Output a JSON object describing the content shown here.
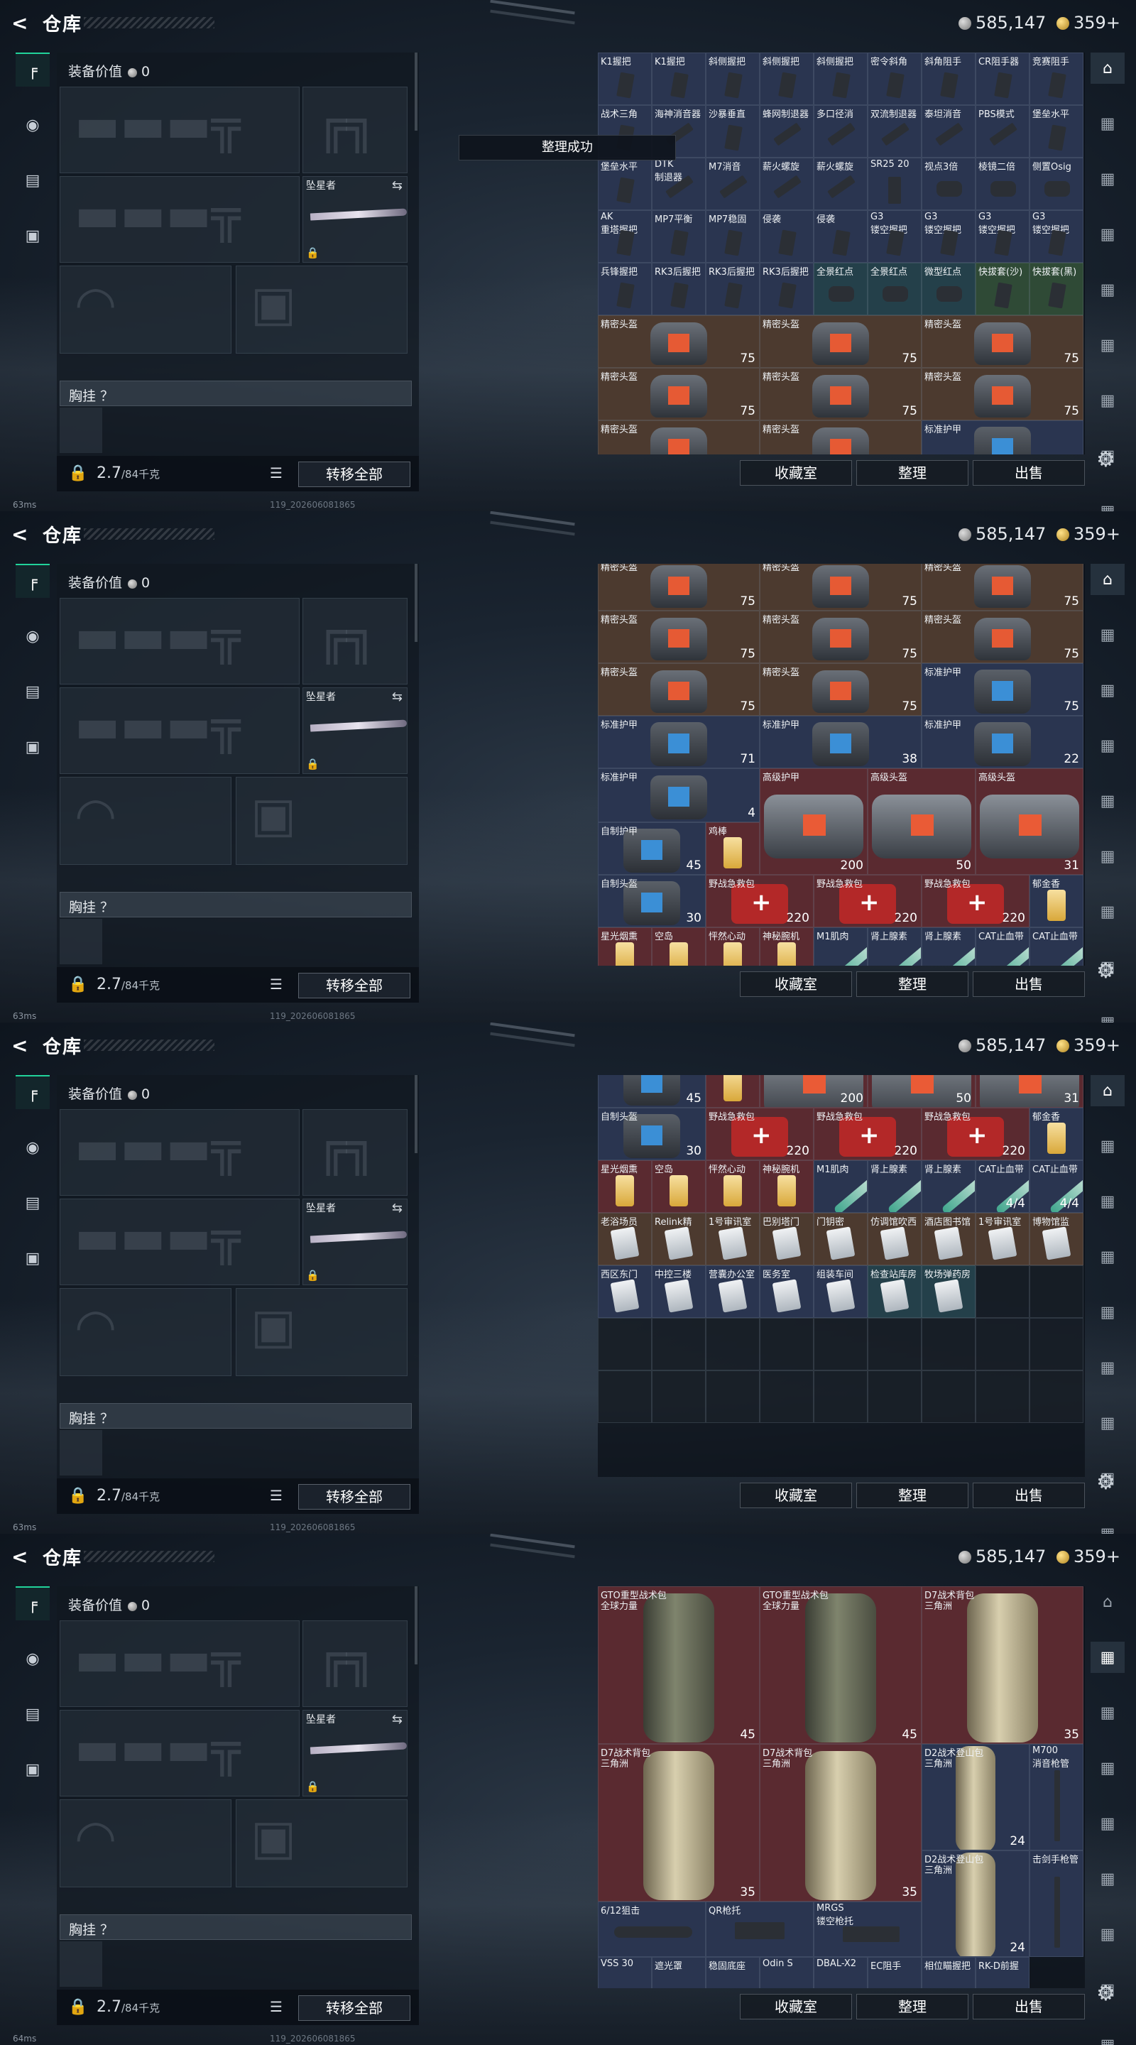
{
  "header": {
    "back_icon": "back-arrow-icon",
    "title": "仓库",
    "silver": "585,147",
    "gold": "359",
    "plus": "+"
  },
  "equipment": {
    "value_label": "装备价值",
    "value": "0",
    "knife_label": "坠星者",
    "chest_label": "胸挂 ？",
    "weight": "2.7",
    "weight_max": "/84千克",
    "transfer_label": "转移全部"
  },
  "toast": "整理成功",
  "buttons": {
    "vault": "收藏室",
    "sort": "整理",
    "sell": "出售"
  },
  "status": {
    "ping1": "63ms",
    "ping2": "63ms",
    "ping3": "63ms",
    "ping4": "64ms",
    "build": "119_202606081865"
  },
  "colors": {
    "blue_cell": "#2a3550",
    "gray_cell": "#2a2f38",
    "brown_cell": "#4c3a2f",
    "red_cell": "#5a2a30",
    "teal_cell": "#24404a",
    "green_cell": "#2f4a36",
    "accent": "#21d39a"
  },
  "frames": [
    {
      "cells": [
        {
          "n": "K1握把",
          "c": "blue",
          "g": "grip"
        },
        {
          "n": "K1握把",
          "c": "blue",
          "g": "grip"
        },
        {
          "n": "斜侧握把",
          "c": "blue",
          "g": "grip"
        },
        {
          "n": "斜侧握把",
          "c": "blue",
          "g": "grip"
        },
        {
          "n": "斜侧握把",
          "c": "blue",
          "g": "grip"
        },
        {
          "n": "密令斜角",
          "c": "blue",
          "g": "grip"
        },
        {
          "n": "斜角阻手",
          "c": "blue",
          "g": "grip"
        },
        {
          "n": "CR阻手器",
          "c": "blue",
          "g": "grip"
        },
        {
          "n": "竞赛阻手",
          "c": "blue",
          "g": "grip"
        },
        {
          "n": "战术三角",
          "c": "blue",
          "g": "grip"
        },
        {
          "n": "海神消音器",
          "c": "blue",
          "g": "sup"
        },
        {
          "n": "沙暴垂直",
          "c": "blue",
          "g": "grip"
        },
        {
          "n": "蜂网制退器",
          "c": "blue",
          "g": "sup"
        },
        {
          "n": "多口径消",
          "c": "blue",
          "g": "sup"
        },
        {
          "n": "双流制退器",
          "c": "blue",
          "g": "sup"
        },
        {
          "n": "泰坦消音",
          "c": "blue",
          "g": "sup"
        },
        {
          "n": "PBS模式",
          "c": "blue",
          "g": "sup"
        },
        {
          "n": "堡垒水平",
          "c": "blue",
          "g": "grip"
        },
        {
          "n": "堡垒水平",
          "c": "blue",
          "g": "grip"
        },
        {
          "n": "DTK",
          "n2": "制退器",
          "c": "blue",
          "g": "sup"
        },
        {
          "n": "M7消音",
          "c": "blue",
          "g": "sup"
        },
        {
          "n": "薪火螺旋",
          "c": "blue",
          "g": "sup"
        },
        {
          "n": "薪火螺旋",
          "c": "blue",
          "g": "sup"
        },
        {
          "n": "SR25 20",
          "c": "blue",
          "g": "mag"
        },
        {
          "n": "视点3倍",
          "c": "blue",
          "g": "scope"
        },
        {
          "n": "棱镜二倍",
          "c": "blue",
          "g": "scope"
        },
        {
          "n": "侧置Osig",
          "c": "blue",
          "g": "scope"
        },
        {
          "n": "AK",
          "n2": "重塔握把",
          "c": "blue",
          "g": "grip"
        },
        {
          "n": "MP7平衡",
          "c": "blue",
          "g": "grip"
        },
        {
          "n": "MP7稳固",
          "c": "blue",
          "g": "grip"
        },
        {
          "n": "侵袭",
          "c": "blue",
          "g": "grip"
        },
        {
          "n": "侵袭",
          "c": "blue",
          "g": "grip"
        },
        {
          "n": "G3",
          "n2": "镂空握把",
          "c": "blue",
          "g": "grip"
        },
        {
          "n": "G3",
          "n2": "镂空握把",
          "c": "blue",
          "g": "grip"
        },
        {
          "n": "G3",
          "n2": "镂空握把",
          "c": "blue",
          "g": "grip"
        },
        {
          "n": "G3",
          "n2": "镂空握把",
          "c": "blue",
          "g": "grip"
        },
        {
          "n": "兵锋握把",
          "c": "blue",
          "g": "grip"
        },
        {
          "n": "RK3后握把",
          "c": "blue",
          "g": "grip"
        },
        {
          "n": "RK3后握把",
          "c": "blue",
          "g": "grip"
        },
        {
          "n": "RK3后握把",
          "c": "blue",
          "g": "grip"
        },
        {
          "n": "全景红点",
          "c": "teal",
          "g": "scope"
        },
        {
          "n": "全景红点",
          "c": "teal",
          "g": "scope"
        },
        {
          "n": "微型红点",
          "c": "teal",
          "g": "scope"
        },
        {
          "n": "快拔套(沙)",
          "c": "green",
          "g": "grip"
        },
        {
          "n": "快拔套(黑)",
          "c": "green",
          "g": "grip"
        }
      ],
      "wide": [
        {
          "n": "精密头盔",
          "v": "75",
          "c": "brown",
          "k": "helm"
        },
        {
          "n": "精密头盔",
          "v": "75",
          "c": "brown",
          "k": "helm"
        },
        {
          "n": "精密头盔",
          "v": "75",
          "c": "brown",
          "k": "helm"
        },
        {
          "n": "精密头盔",
          "v": "75",
          "c": "brown",
          "k": "helm"
        },
        {
          "n": "精密头盔",
          "v": "75",
          "c": "brown",
          "k": "helm"
        },
        {
          "n": "精密头盔",
          "v": "75",
          "c": "brown",
          "k": "helm"
        },
        {
          "n": "精密头盔",
          "v": "",
          "c": "brown",
          "k": "helm"
        },
        {
          "n": "精密头盔",
          "v": "",
          "c": "brown",
          "k": "helm"
        },
        {
          "n": "标准护甲",
          "v": "",
          "c": "blue",
          "k": "vest"
        }
      ]
    },
    {
      "wide": [
        {
          "n": "精密头盔",
          "v": "75",
          "c": "brown",
          "k": "helm"
        },
        {
          "n": "精密头盔",
          "v": "75",
          "c": "brown",
          "k": "helm"
        },
        {
          "n": "精密头盔",
          "v": "75",
          "c": "brown",
          "k": "helm"
        },
        {
          "n": "精密头盔",
          "v": "75",
          "c": "brown",
          "k": "helm"
        },
        {
          "n": "精密头盔",
          "v": "75",
          "c": "brown",
          "k": "helm"
        },
        {
          "n": "精密头盔",
          "v": "75",
          "c": "brown",
          "k": "helm"
        },
        {
          "n": "精密头盔",
          "v": "75",
          "c": "brown",
          "k": "helm"
        },
        {
          "n": "精密头盔",
          "v": "75",
          "c": "brown",
          "k": "helm"
        },
        {
          "n": "标准护甲",
          "v": "75",
          "c": "blue",
          "k": "vest"
        },
        {
          "n": "标准护甲",
          "v": "71",
          "c": "blue",
          "k": "vest"
        },
        {
          "n": "标准护甲",
          "v": "38",
          "c": "blue",
          "k": "vest"
        },
        {
          "n": "标准护甲",
          "v": "22",
          "c": "blue",
          "k": "vest"
        },
        {
          "n": "标准护甲",
          "v": "4",
          "c": "blue",
          "k": "vest"
        },
        {
          "n": "高级护甲",
          "v": "200",
          "c": "red",
          "k": "bigvest"
        },
        {
          "n": "高级头盔",
          "v": "50",
          "c": "red",
          "k": "bigvest"
        },
        {
          "n": "高级头盔",
          "v": "31",
          "c": "red",
          "k": "bigvest"
        }
      ],
      "misc": [
        {
          "n": "自制护甲",
          "v": "45",
          "c": "blue"
        },
        {
          "n": "鸡棒",
          "v": "",
          "c": "red"
        },
        {
          "n": "自制头盔",
          "v": "30",
          "c": "blue"
        },
        {
          "n": "野战急救包",
          "v": "220",
          "c": "red"
        },
        {
          "n": "野战急救包",
          "v": "220",
          "c": "red"
        },
        {
          "n": "野战急救包",
          "v": "220",
          "c": "red"
        },
        {
          "n": "郁金香",
          "v": "",
          "c": "blue"
        },
        {
          "n": "星光烟熏",
          "c": "red"
        },
        {
          "n": "空岛",
          "c": "red"
        },
        {
          "n": "怦然心动",
          "c": "red"
        },
        {
          "n": "神秘腕机",
          "c": "red"
        },
        {
          "n": "M1肌肉",
          "c": "blue"
        },
        {
          "n": "肾上腺素",
          "c": "blue"
        },
        {
          "n": "肾上腺素",
          "c": "blue"
        },
        {
          "n": "CAT止血带",
          "c": "blue"
        },
        {
          "n": "CAT止血带",
          "c": "blue"
        }
      ]
    },
    {
      "row1": [
        {
          "n": "星光烟熏",
          "c": "red",
          "k": "drink"
        },
        {
          "n": "空岛",
          "c": "red",
          "k": "drink"
        },
        {
          "n": "怦然心动",
          "c": "red",
          "k": "drink"
        },
        {
          "n": "神秘腕机",
          "c": "red",
          "k": "drink"
        },
        {
          "n": "M1肌肉",
          "c": "blue",
          "k": "tube"
        },
        {
          "n": "肾上腺素",
          "c": "blue",
          "k": "tube"
        },
        {
          "n": "肾上腺素",
          "c": "blue",
          "k": "tube"
        },
        {
          "n": "CAT止血带",
          "v": "4/4",
          "c": "blue",
          "k": "tube"
        },
        {
          "n": "CAT止血带",
          "v": "4/4",
          "c": "blue",
          "k": "tube"
        }
      ],
      "row2": [
        {
          "n": "老浴场员",
          "c": "brown",
          "k": "card"
        },
        {
          "n": "Relink精",
          "c": "brown",
          "k": "card"
        },
        {
          "n": "1号审讯室",
          "c": "brown",
          "k": "card"
        },
        {
          "n": "巴别塔门",
          "c": "brown",
          "k": "card"
        },
        {
          "n": "门钥密",
          "c": "brown",
          "k": "card"
        },
        {
          "n": "仿调馆吹西",
          "c": "brown",
          "k": "card"
        },
        {
          "n": "酒店图书馆",
          "c": "brown",
          "k": "card"
        },
        {
          "n": "1号审讯室",
          "c": "brown",
          "k": "card"
        },
        {
          "n": "博物馆监",
          "c": "brown",
          "k": "card"
        }
      ],
      "row3": [
        {
          "n": "西区东门",
          "c": "blue",
          "k": "card"
        },
        {
          "n": "中控三楼",
          "c": "blue",
          "k": "card"
        },
        {
          "n": "营囊办公室",
          "c": "blue",
          "k": "card"
        },
        {
          "n": "医务室",
          "c": "blue",
          "k": "card"
        },
        {
          "n": "组装车间",
          "c": "blue",
          "k": "card"
        },
        {
          "n": "检查站库房",
          "c": "teal",
          "k": "card"
        },
        {
          "n": "牧场弹药房",
          "c": "teal",
          "k": "card"
        }
      ]
    },
    {
      "bags": [
        {
          "n": "GTO重型战术包",
          "n2": "全球力量",
          "v": "45",
          "c": "red",
          "k": "bag"
        },
        {
          "n": "GTO重型战术包",
          "n2": "全球力量",
          "v": "45",
          "c": "red",
          "k": "bag"
        },
        {
          "n": "D7战术背包",
          "n2": "三角洲",
          "v": "35",
          "c": "red",
          "k": "bag tan"
        },
        {
          "n": "D7战术背包",
          "n2": "三角洲",
          "v": "35",
          "c": "red",
          "k": "bag tan"
        },
        {
          "n": "D7战术背包",
          "n2": "三角洲",
          "v": "35",
          "c": "red",
          "k": "bag tan"
        }
      ],
      "side": [
        {
          "n": "D2战术登山包",
          "n2": "三角洲",
          "v": "24"
        },
        {
          "n": "M700",
          "n2": "消音枪管"
        },
        {
          "n": "D2战术登山包",
          "n2": "三角洲",
          "v": "24"
        },
        {
          "n": "击剑手枪管"
        }
      ],
      "bottom": [
        {
          "n": "6/12狙击",
          "c": "blue"
        },
        {
          "n": "QR枪托",
          "c": "blue"
        },
        {
          "n": "MRGS",
          "n2": "镂空枪托",
          "c": "blue"
        },
        {
          "n": "VSS 30",
          "c": "blue"
        },
        {
          "n": "遮光罩",
          "c": "blue"
        },
        {
          "n": "稳固底座",
          "c": "blue"
        },
        {
          "n": "Odin S",
          "c": "blue"
        },
        {
          "n": "DBAL-X2",
          "c": "blue"
        },
        {
          "n": "EC阻手",
          "c": "blue"
        },
        {
          "n": "相位瞄握把",
          "c": "blue"
        },
        {
          "n": "RK-D前握",
          "c": "blue"
        }
      ]
    }
  ]
}
